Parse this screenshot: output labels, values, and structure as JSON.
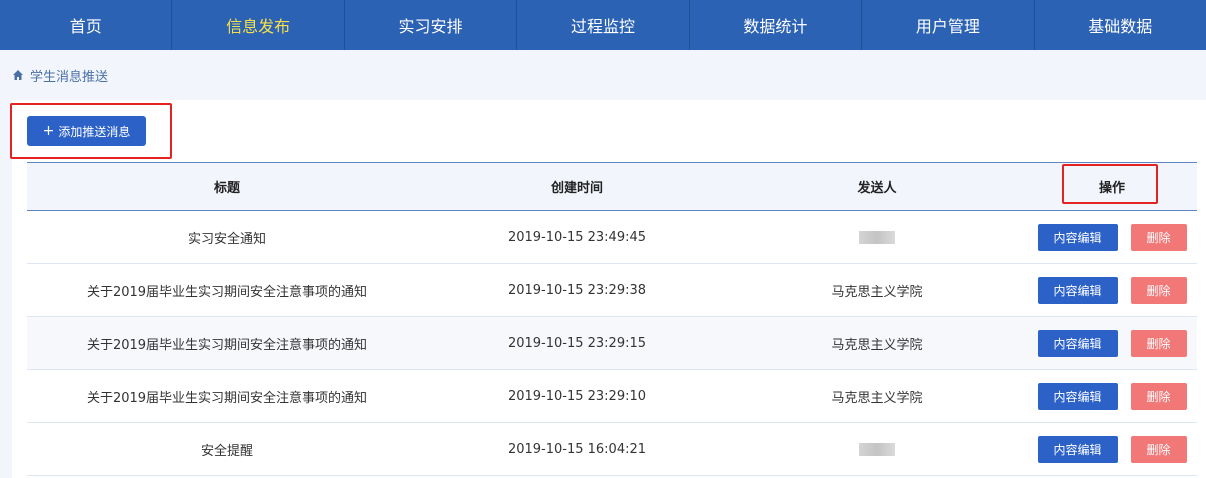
{
  "nav": [
    {
      "label": "首页",
      "active": false
    },
    {
      "label": "信息发布",
      "active": true
    },
    {
      "label": "实习安排",
      "active": false
    },
    {
      "label": "过程监控",
      "active": false
    },
    {
      "label": "数据统计",
      "active": false
    },
    {
      "label": "用户管理",
      "active": false
    },
    {
      "label": "基础数据",
      "active": false
    }
  ],
  "breadcrumb": {
    "icon": "home-icon",
    "label": "学生消息推送"
  },
  "toolbar": {
    "add_label": "添加推送消息",
    "add_icon": "plus-icon"
  },
  "table": {
    "headers": [
      "标题",
      "创建时间",
      "发送人",
      "操作"
    ],
    "rows": [
      {
        "title": "实习安全通知",
        "created": "2019-10-15 23:49:45",
        "sender": "",
        "sender_blurred": true
      },
      {
        "title": "关于2019届毕业生实习期间安全注意事项的通知",
        "created": "2019-10-15 23:29:38",
        "sender": "马克思主义学院",
        "sender_blurred": false
      },
      {
        "title": "关于2019届毕业生实习期间安全注意事项的通知",
        "created": "2019-10-15 23:29:15",
        "sender": "马克思主义学院",
        "sender_blurred": false
      },
      {
        "title": "关于2019届毕业生实习期间安全注意事项的通知",
        "created": "2019-10-15 23:29:10",
        "sender": "马克思主义学院",
        "sender_blurred": false
      },
      {
        "title": "安全提醒",
        "created": "2019-10-15 16:04:21",
        "sender": "",
        "sender_blurred": true
      }
    ],
    "edit_label": "内容编辑",
    "delete_label": "删除"
  },
  "colors": {
    "nav_bg": "#2b62b4",
    "nav_active": "#f5e04a",
    "primary": "#2c62c8",
    "danger": "#f27878",
    "highlight": "#e52222"
  }
}
